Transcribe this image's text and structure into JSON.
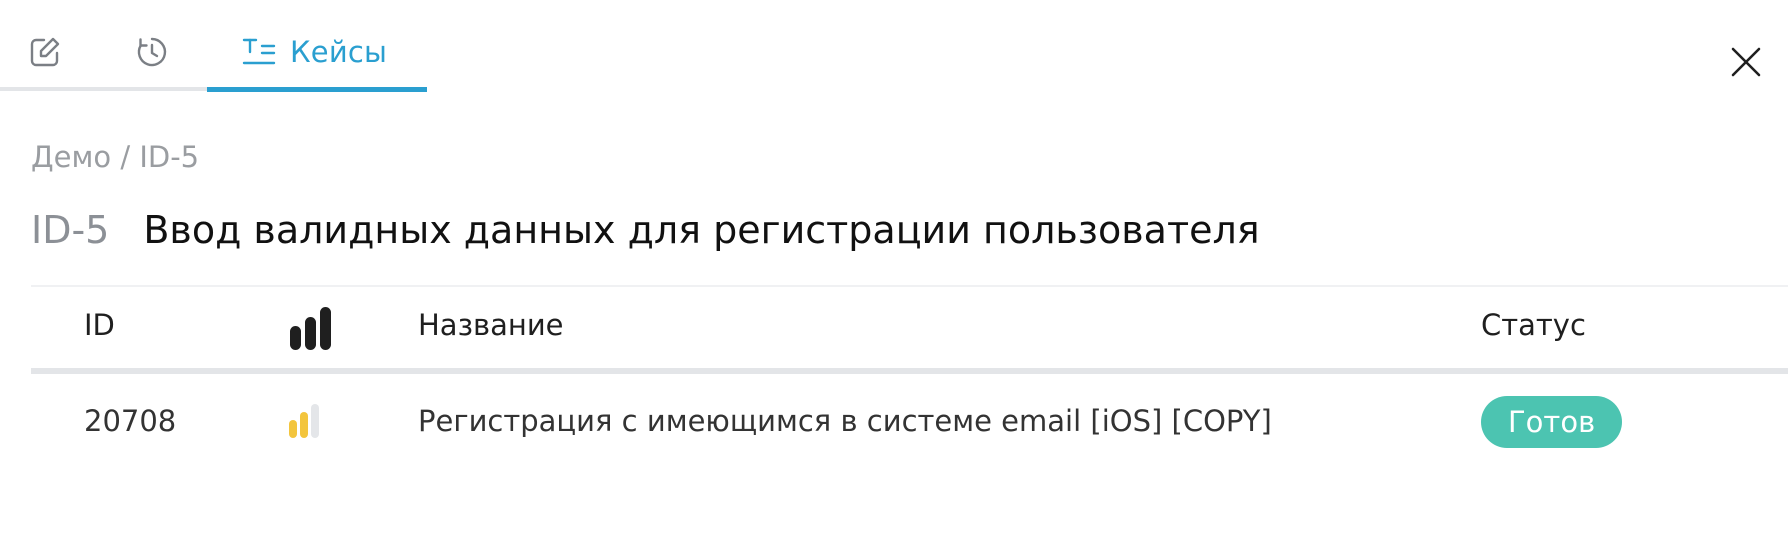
{
  "tabs": {
    "edit_icon": "edit-icon",
    "history_icon": "history-icon",
    "cases_icon": "test-cases-icon",
    "cases_label": "Кейсы"
  },
  "breadcrumb": "Демо / ID-5",
  "title": {
    "id": "ID-5",
    "text": "Ввод валидных данных для регистрации пользователя"
  },
  "table": {
    "headers": {
      "id": "ID",
      "priority_icon": "priority-icon",
      "name": "Название",
      "status": "Статус"
    },
    "rows": [
      {
        "id": "20708",
        "priority": "low",
        "name": "Регистрация с имеющимся в системе email [iOS] [COPY]",
        "status": "Готов"
      }
    ]
  },
  "colors": {
    "accent": "#2a9fd0",
    "status_ready": "#4cc4b1",
    "priority_low": "#f3c53d",
    "priority_inactive": "#e4e6e9"
  }
}
